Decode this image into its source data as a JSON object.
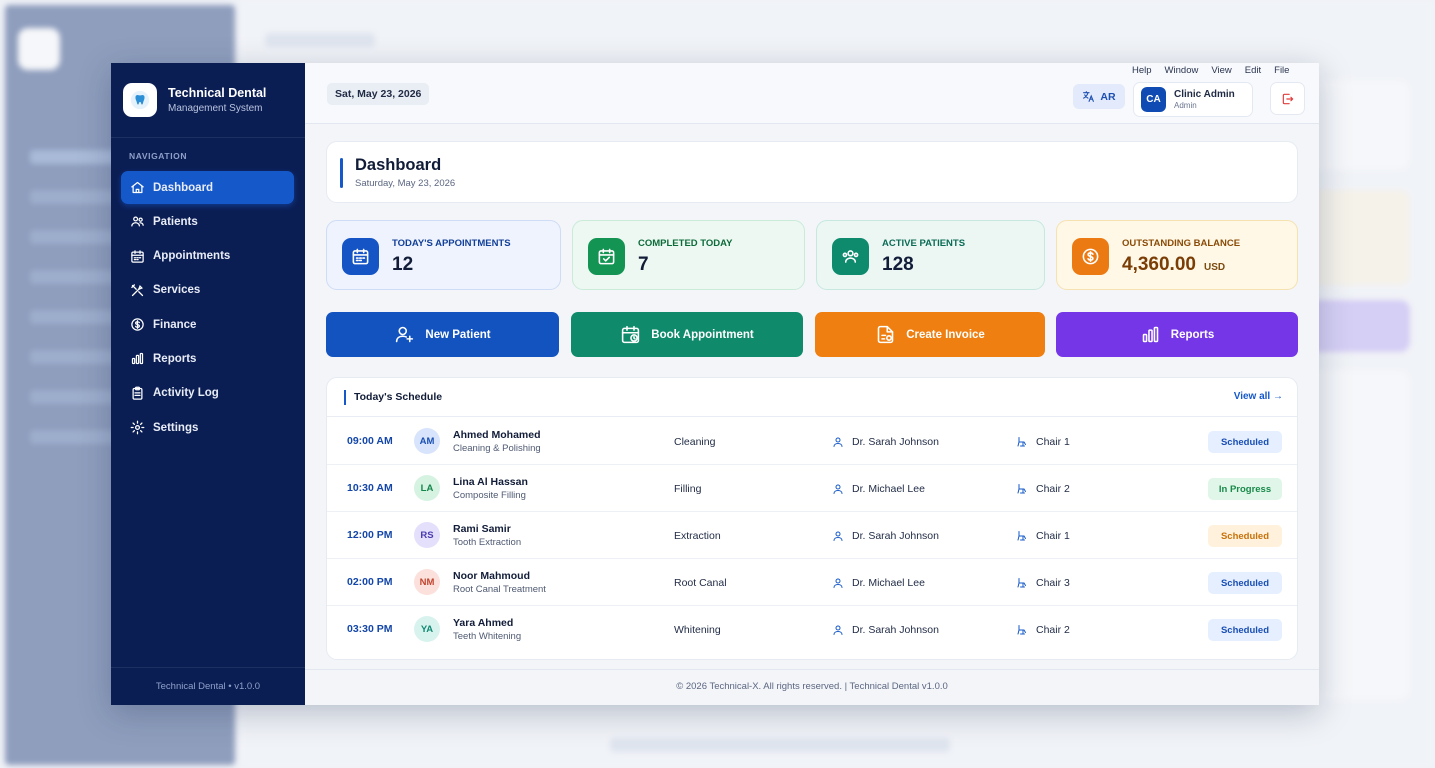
{
  "app": {
    "brand_title": "Technical Dental",
    "brand_subtitle": "Management System",
    "version_footer": "Technical Dental  •  v1.0.0",
    "footer": "© 2026 Technical-X. All rights reserved. | Technical Dental v1.0.0"
  },
  "sidebar": {
    "section_label": "NAVIGATION",
    "items": [
      {
        "label": "Dashboard",
        "icon": "home-icon",
        "active": true
      },
      {
        "label": "Patients",
        "icon": "users-icon"
      },
      {
        "label": "Appointments",
        "icon": "calendar-icon"
      },
      {
        "label": "Services",
        "icon": "tools-icon"
      },
      {
        "label": "Finance",
        "icon": "dollar-icon"
      },
      {
        "label": "Reports",
        "icon": "bar-chart-icon"
      },
      {
        "label": "Activity Log",
        "icon": "clipboard-icon"
      },
      {
        "label": "Settings",
        "icon": "gear-icon"
      }
    ]
  },
  "topbar": {
    "date": "Sat, May 23, 2026",
    "menu": [
      "Help",
      "Window",
      "View",
      "Edit",
      "File"
    ],
    "language": "AR",
    "user_initials": "CA",
    "user_name": "Clinic Admin",
    "user_role": "Admin"
  },
  "page": {
    "title": "Dashboard",
    "subtitle": "Saturday, May 23, 2026"
  },
  "stats": [
    {
      "label": "TODAY'S APPOINTMENTS",
      "value": "12",
      "unit": ""
    },
    {
      "label": "COMPLETED TODAY",
      "value": "7",
      "unit": ""
    },
    {
      "label": "ACTIVE PATIENTS",
      "value": "128",
      "unit": ""
    },
    {
      "label": "OUTSTANDING BALANCE",
      "value": "4,360.00",
      "unit": "USD"
    }
  ],
  "actions": [
    {
      "label": "New Patient"
    },
    {
      "label": "Book Appointment"
    },
    {
      "label": "Create Invoice"
    },
    {
      "label": "Reports"
    }
  ],
  "schedule": {
    "title": "Today's Schedule",
    "view_all": "View all →",
    "rows": [
      {
        "time": "09:00 AM",
        "initials": "AM",
        "name": "Ahmed Mohamed",
        "procedure": "Cleaning & Polishing",
        "service": "Cleaning",
        "doctor": "Dr. Sarah Johnson",
        "chair": "Chair 1",
        "status": "Scheduled"
      },
      {
        "time": "10:30 AM",
        "initials": "LA",
        "name": "Lina Al Hassan",
        "procedure": "Composite Filling",
        "service": "Filling",
        "doctor": "Dr. Michael Lee",
        "chair": "Chair 2",
        "status": "In Progress"
      },
      {
        "time": "12:00 PM",
        "initials": "RS",
        "name": "Rami Samir",
        "procedure": "Tooth Extraction",
        "service": "Extraction",
        "doctor": "Dr. Sarah Johnson",
        "chair": "Chair 1",
        "status": "Scheduled"
      },
      {
        "time": "02:00 PM",
        "initials": "NM",
        "name": "Noor Mahmoud",
        "procedure": "Root Canal Treatment",
        "service": "Root Canal",
        "doctor": "Dr. Michael Lee",
        "chair": "Chair 3",
        "status": "Scheduled"
      },
      {
        "time": "03:30 PM",
        "initials": "YA",
        "name": "Yara Ahmed",
        "procedure": "Teeth Whitening",
        "service": "Whitening",
        "doctor": "Dr. Sarah Johnson",
        "chair": "Chair 2",
        "status": "Scheduled"
      }
    ]
  },
  "colors": {
    "sidebar": "#0b1e54",
    "primary": "#1558c9",
    "green": "#0f8a6a",
    "orange": "#ee7f10",
    "purple": "#7436e6"
  }
}
